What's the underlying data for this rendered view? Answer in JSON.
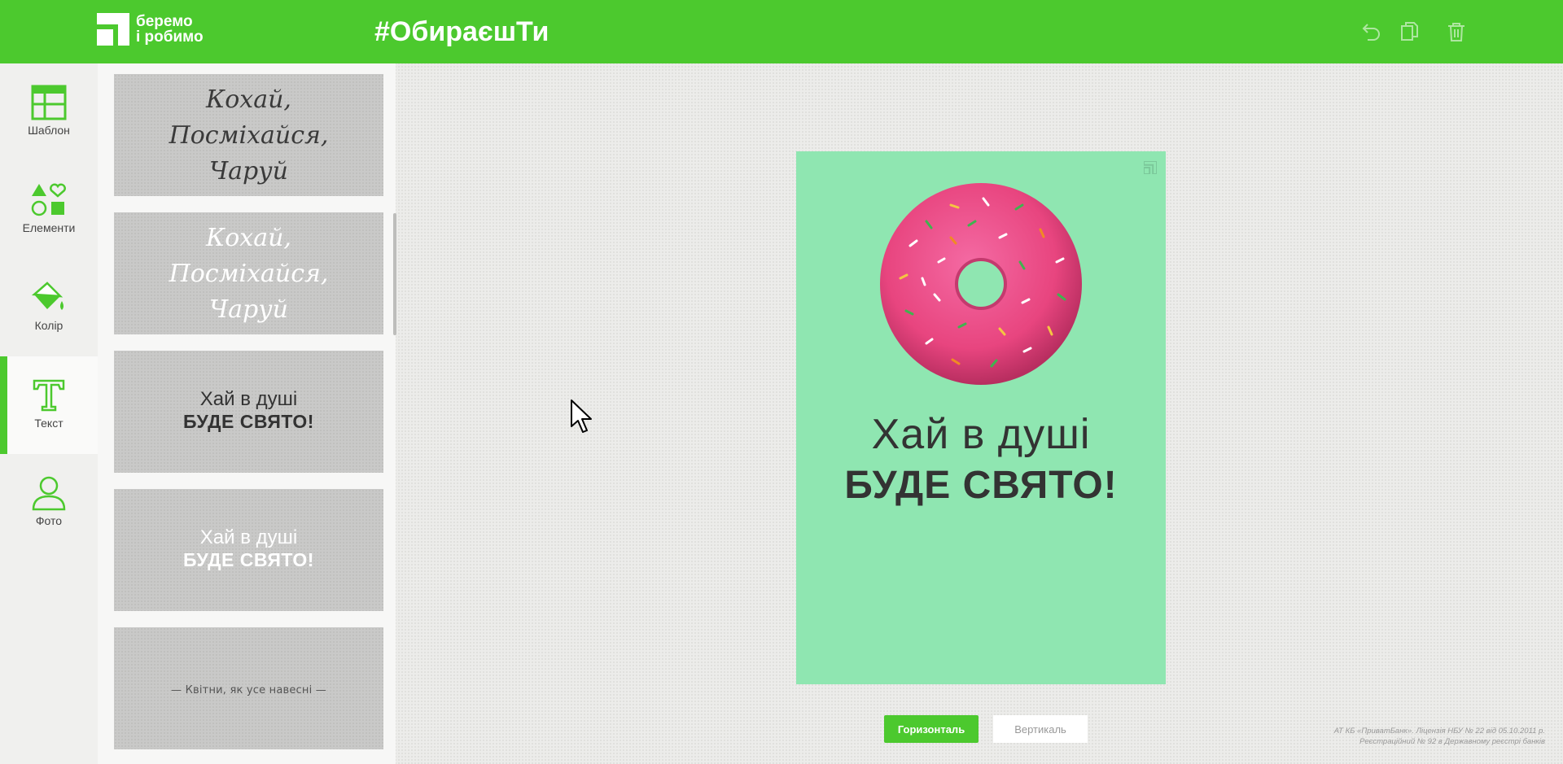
{
  "header": {
    "logo_line1": "беремо",
    "logo_line2": "і робимо",
    "hashtag": "#ОбираєшТи",
    "icons": [
      "undo-icon",
      "copy-icon",
      "trash-icon"
    ]
  },
  "tools": [
    {
      "label": "Шаблон",
      "icon": "template-icon",
      "active": false
    },
    {
      "label": "Елементи",
      "icon": "shapes-icon",
      "active": false
    },
    {
      "label": "Колір",
      "icon": "paint-bucket-icon",
      "active": false
    },
    {
      "label": "Текст",
      "icon": "text-icon",
      "active": true
    },
    {
      "label": "Фото",
      "icon": "person-icon",
      "active": false
    }
  ],
  "templates": [
    {
      "lines": [
        "Кохай,",
        "Посміхайся,",
        "Чаруй"
      ],
      "color": "#3a3a3a"
    },
    {
      "lines": [
        "Кохай,",
        "Посміхайся,",
        "Чаруй"
      ],
      "color": "#ffffff"
    },
    {
      "line1": "Хай в душі",
      "line2": "БУДЕ СВЯТО!",
      "color": "#333333"
    },
    {
      "line1": "Хай в душі",
      "line2": "БУДЕ СВЯТО!",
      "color": "#ffffff"
    },
    {
      "text": "— Квітни, як усе навесні —",
      "color": "#555555"
    }
  ],
  "canvas": {
    "line1": "Хай в душі",
    "line2": "БУДЕ СВЯТО!",
    "background": "#8fe6b1",
    "donut_color": "#ef4f8f"
  },
  "orientation": {
    "horizontal": "Горизонталь",
    "vertical": "Вертикаль"
  },
  "legal": {
    "line1": "АТ КБ «ПриватБанк». Ліцензія НБУ № 22 від 05.10.2011 р.",
    "line2": "Реєстраційний № 92 в Державному реєстрі банків"
  },
  "colors": {
    "accent": "#4cc92e"
  }
}
